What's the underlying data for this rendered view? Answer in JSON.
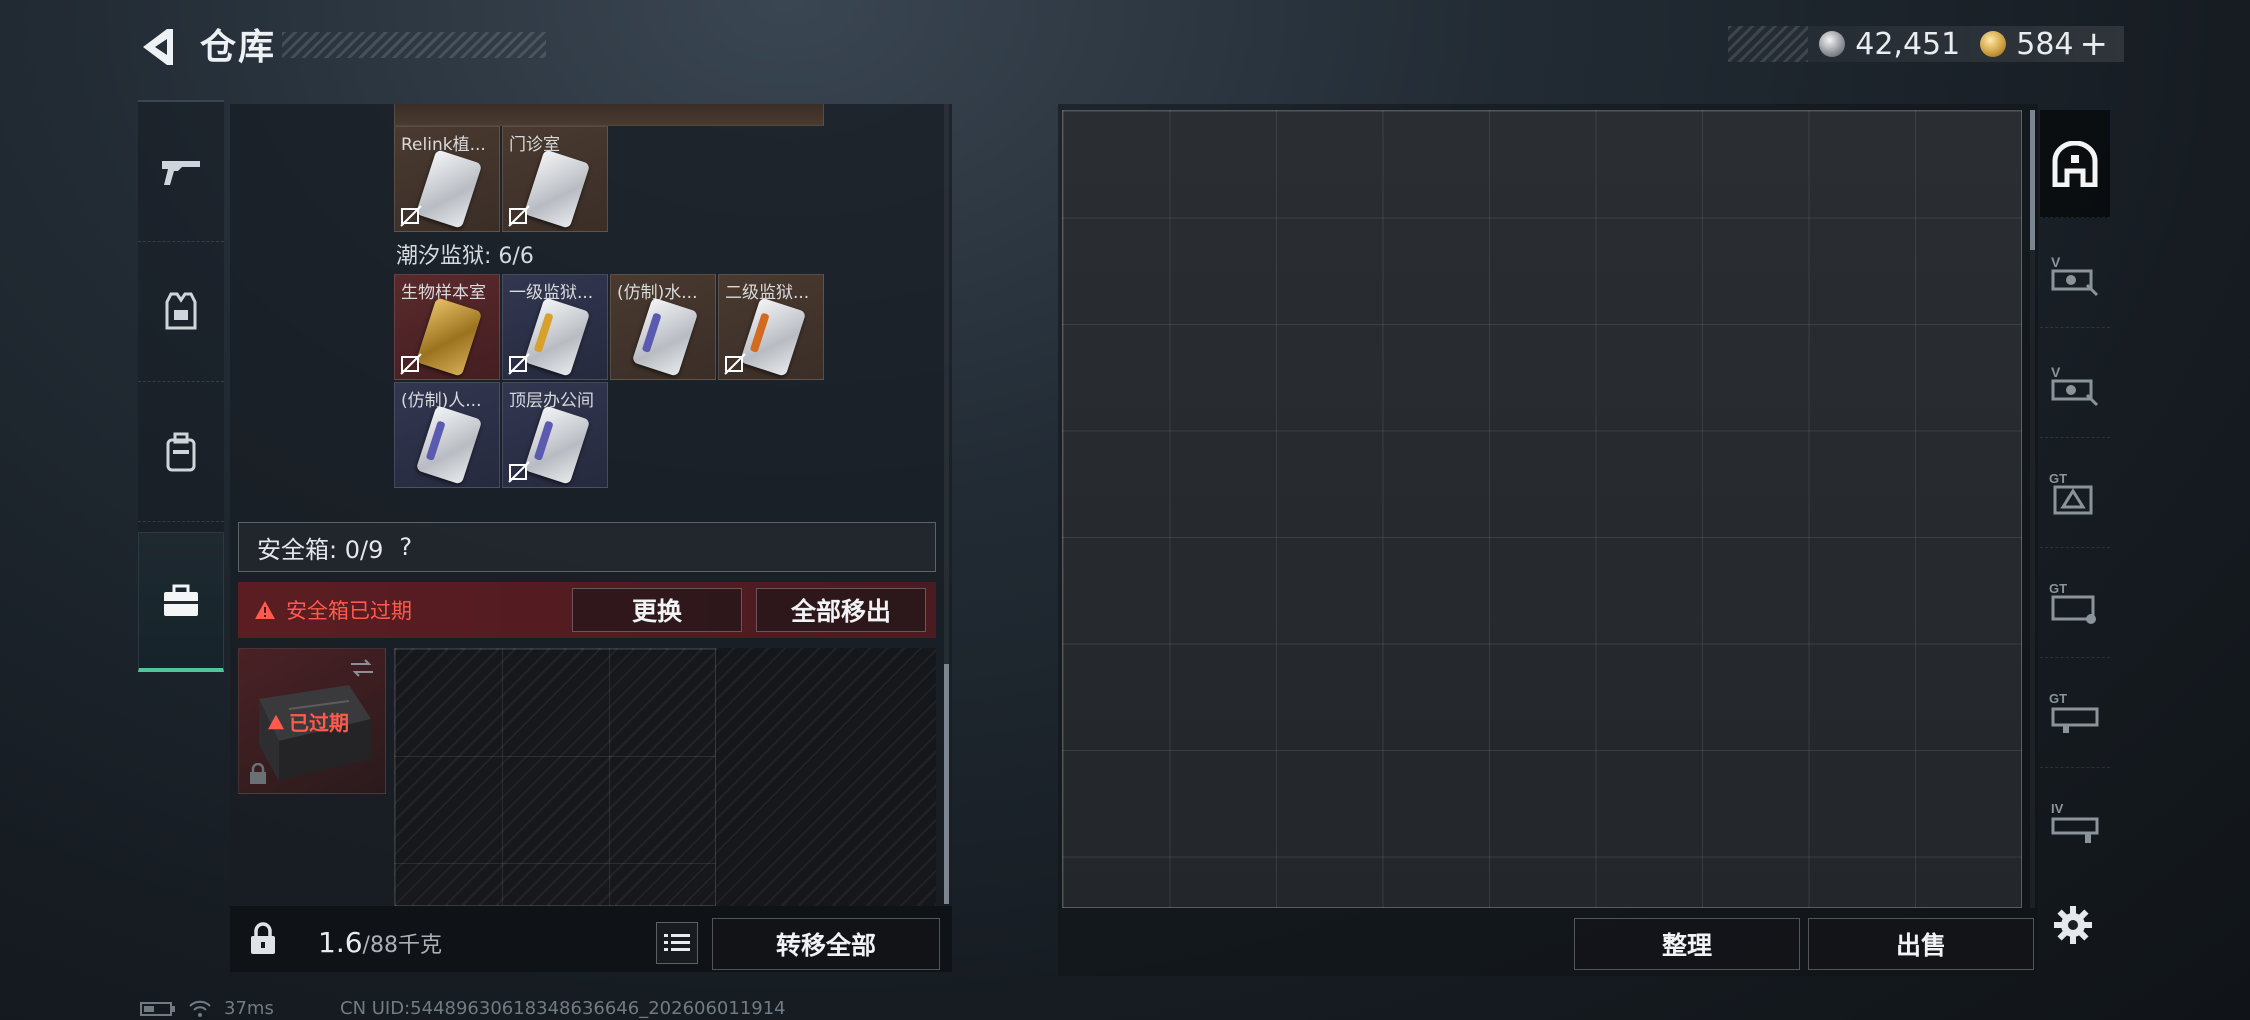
{
  "header": {
    "title": "仓库",
    "back_icon": "back-arrow-icon",
    "currency": [
      {
        "icon": "silver-coin-icon",
        "value": "42,451"
      },
      {
        "icon": "gold-coin-icon",
        "value": "584"
      }
    ],
    "add_label": "+"
  },
  "categories": [
    {
      "id": "weapons",
      "icon": "gun-icon",
      "active": false
    },
    {
      "id": "armor",
      "icon": "armor-vest-icon",
      "active": false
    },
    {
      "id": "backpack",
      "icon": "backpack-icon",
      "active": false
    },
    {
      "id": "case",
      "icon": "toolbox-icon",
      "active": true
    }
  ],
  "keycards_top": [
    {
      "name": "Relink植...",
      "color": "brown",
      "img": "white"
    },
    {
      "name": "门诊室",
      "color": "brown",
      "img": "white"
    }
  ],
  "prison_section": {
    "label": "潮汐监狱: 6/6",
    "cards": [
      {
        "name": "生物样本室",
        "color": "red",
        "img": "gold"
      },
      {
        "name": "一级监狱...",
        "color": "blue",
        "img": "white",
        "stripe": "#d7a12b"
      },
      {
        "name": "(仿制)水...",
        "color": "brown",
        "img": "white",
        "stripe": "#5a5bb0"
      },
      {
        "name": "二级监狱...",
        "color": "brown",
        "img": "white",
        "stripe": "#d26b1e"
      },
      {
        "name": "(仿制)人...",
        "color": "blue",
        "img": "white",
        "stripe": "#5a5bb0"
      },
      {
        "name": "顶层办公间",
        "color": "blue",
        "img": "white",
        "stripe": "#5a5bb0"
      }
    ]
  },
  "safe": {
    "label": "安全箱: 0/9",
    "help": "?",
    "expired_warning": "安全箱已过期",
    "replace_button": "更换",
    "remove_all_button": "全部移出",
    "expired_badge": "已过期"
  },
  "footer_left": {
    "weight_value": "1.6",
    "weight_capacity": "/88千克",
    "transfer_all": "转移全部"
  },
  "footer_right": {
    "sort_button": "整理",
    "sell_button": "出售"
  },
  "side_icons": [
    {
      "icon": "storage-home-icon",
      "label": ""
    },
    {
      "icon": "storage-v-icon",
      "label": "V"
    },
    {
      "icon": "storage-v-icon",
      "label": "V"
    },
    {
      "icon": "storage-gt-icon",
      "label": "GT"
    },
    {
      "icon": "storage-gt-icon",
      "label": "GT"
    },
    {
      "icon": "storage-gt-icon",
      "label": "GT"
    },
    {
      "icon": "storage-iv-icon",
      "label": "IV"
    }
  ],
  "status": {
    "ping": "37ms",
    "uid": "CN UID:5448963061834863664​6_202606011914"
  },
  "colors": {
    "accent_green": "#4fc79a",
    "warning_red": "#ff5a4c"
  }
}
